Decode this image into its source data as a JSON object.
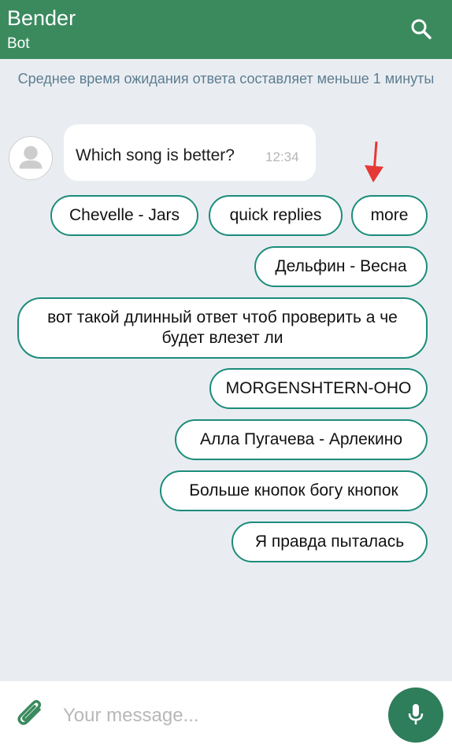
{
  "header": {
    "title": "Bender",
    "subtitle": "Bot",
    "search_icon": "search-icon"
  },
  "chat": {
    "wait_notice": "Среднее время ожидания ответа составляет меньше 1 минуты",
    "message": {
      "text": "Which song is better?",
      "time": "12:34"
    },
    "quick_replies": [
      "Chevelle - Jars",
      "quick replies",
      "more",
      "Дельфин - Весна",
      "вот такой длинный ответ чтоб проверить а че будет влезет ли",
      "MORGENSHTERN-OHO",
      "Алла Пугачева - Арлекино",
      "Больше кнопок богу кнопок",
      "Я правда пыталась"
    ]
  },
  "composer": {
    "placeholder": "Your message...",
    "attach_icon": "paperclip-icon",
    "mic_icon": "microphone-icon"
  },
  "colors": {
    "header": "#3a8a5e",
    "accent_border": "#1c8c7b",
    "mic_button": "#2e7d5b",
    "background": "#e9edf1",
    "annotation_arrow": "#e53935"
  }
}
